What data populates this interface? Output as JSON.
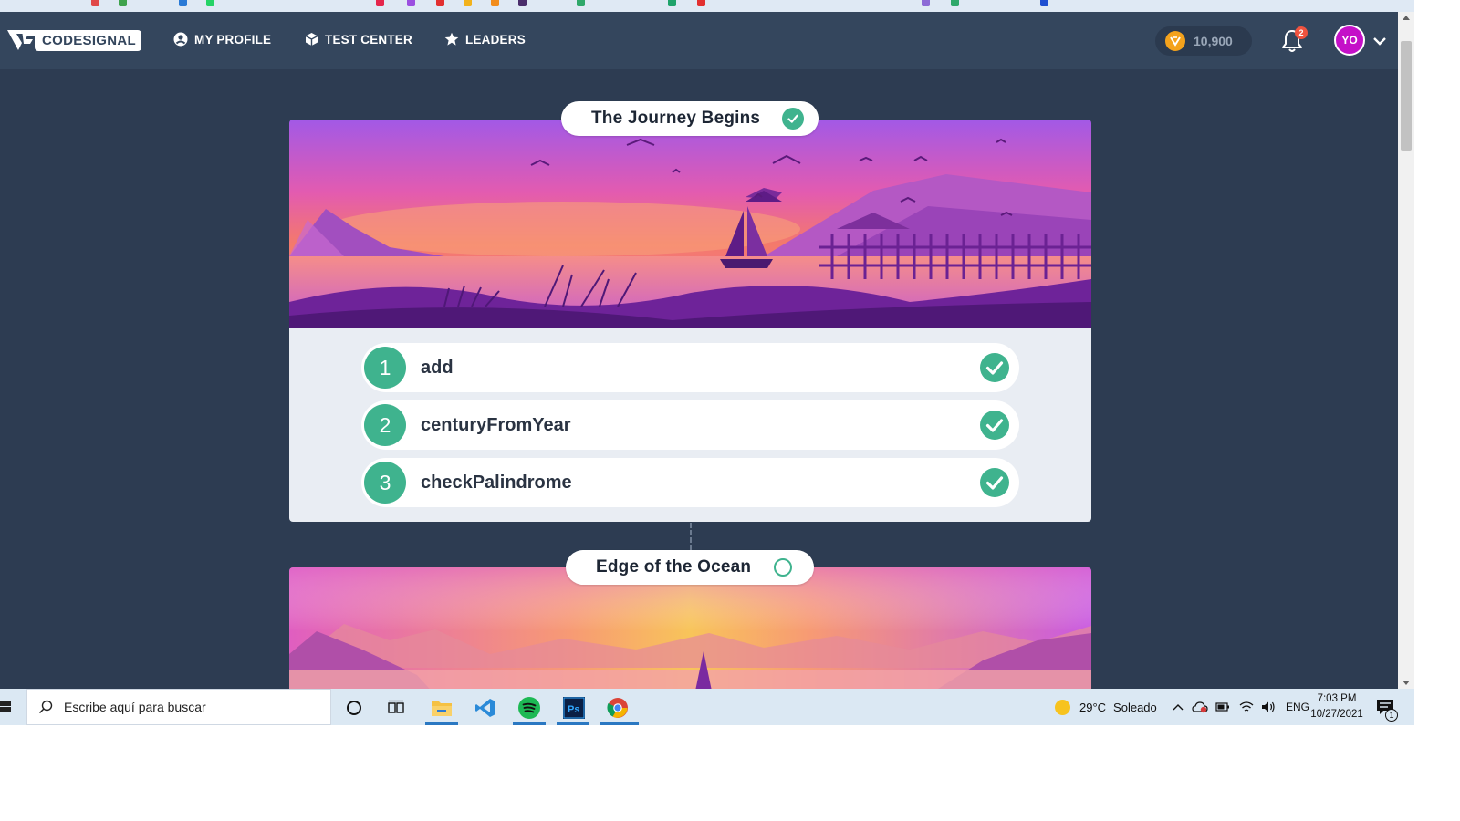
{
  "nav": {
    "logo_text": "CODESIGNAL",
    "my_profile": "MY PROFILE",
    "test_center": "TEST CENTER",
    "leaders": "LEADERS",
    "coins": "10,900",
    "notification_count": "2",
    "avatar_initials": "YO"
  },
  "sections": [
    {
      "title": "The Journey Begins",
      "status": "completed",
      "tasks": [
        {
          "number": "1",
          "name": "add",
          "status": "completed"
        },
        {
          "number": "2",
          "name": "centuryFromYear",
          "status": "completed"
        },
        {
          "number": "3",
          "name": "checkPalindrome",
          "status": "completed"
        }
      ]
    },
    {
      "title": "Edge of the Ocean",
      "status": "incomplete"
    }
  ],
  "taskbar": {
    "search_placeholder": "Escribe aquí para buscar",
    "weather_temp": "29°C",
    "weather_text": "Soleado",
    "language": "ENG",
    "time": "7:03 PM",
    "date": "10/27/2021",
    "notification_count": "1",
    "apps": [
      "cortana-icon",
      "task-view-icon",
      "file-explorer-icon",
      "vscode-icon",
      "spotify-icon",
      "photoshop-icon",
      "chrome-icon"
    ]
  },
  "colors": {
    "app_background": "#2d3c52",
    "nav_background": "#34465d",
    "accent_green": "#3fb38e",
    "coin_orange": "#f4a21c",
    "avatar_magenta": "#c410c8"
  }
}
